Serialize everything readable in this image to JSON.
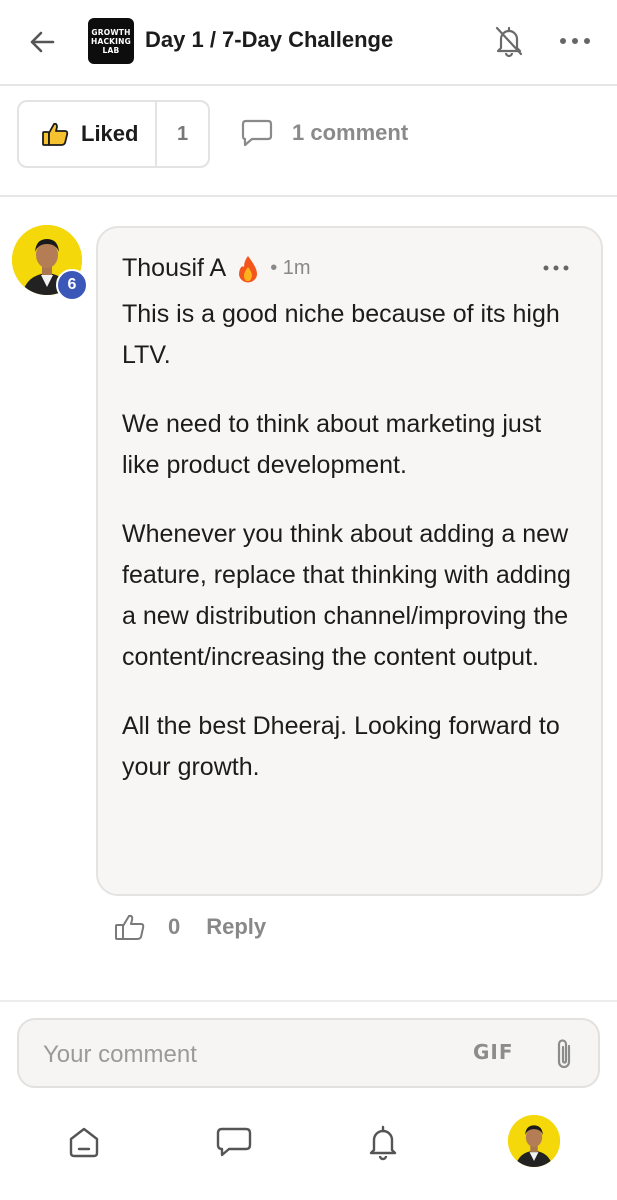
{
  "header": {
    "logo_lines": [
      "GROWTH",
      "HACKING",
      "LAB"
    ],
    "title": "Day 1 / 7-Day Challenge"
  },
  "reactions": {
    "like_label": "Liked",
    "like_count": "1",
    "comment_label": "1 comment"
  },
  "comment": {
    "author": "Thousif A",
    "time": "• 1m",
    "level": "6",
    "paragraphs": [
      "This is a good niche because of its high LTV.",
      "We need to think about marketing just like product development.",
      "Whenever you think about adding a new feature, replace that thinking with adding a new distribution channel/improving the content/increasing the content output.",
      "All the best Dheeraj. Looking forward to your growth."
    ],
    "like_count": "0",
    "reply_label": "Reply"
  },
  "composer": {
    "placeholder": "Your comment",
    "gif_label": "GIF"
  },
  "colors": {
    "accent_badge": "#3b57b8",
    "avatar_bg": "#f4d80a"
  },
  "icons": {
    "back": "arrow-left-icon",
    "notifications_off": "bell-off-icon",
    "more": "more-horizontal-icon",
    "like": "thumbs-up-icon",
    "comment": "comment-bubble-icon",
    "flame": "fire-emoji-icon",
    "attach": "paperclip-icon",
    "home": "home-icon",
    "chat": "chat-icon",
    "bell": "bell-icon"
  }
}
